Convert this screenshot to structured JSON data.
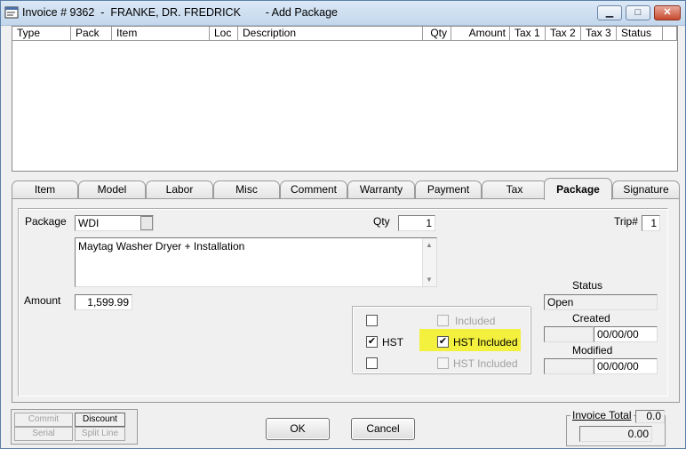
{
  "window": {
    "title": "Invoice # 9362  -  FRANKE, DR. FREDRICK        - Add Package",
    "minimize_glyph": "▁",
    "maximize_glyph": "□",
    "close_glyph": "✕"
  },
  "grid": {
    "columns": [
      "Type",
      "Pack",
      "Item",
      "Loc",
      "Description",
      "Qty",
      "Amount",
      "Tax 1",
      "Tax 2",
      "Tax 3",
      "Status"
    ]
  },
  "tabs": [
    {
      "label": "Item",
      "active": false
    },
    {
      "label": "Model",
      "active": false
    },
    {
      "label": "Labor",
      "active": false
    },
    {
      "label": "Misc",
      "active": false
    },
    {
      "label": "Comment",
      "active": false
    },
    {
      "label": "Warranty",
      "active": false
    },
    {
      "label": "Payment",
      "active": false
    },
    {
      "label": "Tax",
      "active": false
    },
    {
      "label": "Package",
      "active": true
    },
    {
      "label": "Signature",
      "active": false
    }
  ],
  "package": {
    "package_label": "Package",
    "package_value": "WDI",
    "qty_label": "Qty",
    "qty_value": "1",
    "trip_label": "Trip#",
    "trip_value": "1",
    "description": "Maytag Washer Dryer + Installation",
    "amount_label": "Amount",
    "amount_value": "1,599.99"
  },
  "tax": {
    "row1": {
      "label": "",
      "checked": false,
      "included_label": "Included",
      "included_checked": false
    },
    "row2": {
      "label": "HST",
      "checked": true,
      "included_label": "HST Included",
      "included_checked": true
    },
    "row3": {
      "label": "",
      "checked": false,
      "included_label": "HST Included",
      "included_checked": false
    }
  },
  "status": {
    "status_label": "Status",
    "status_value": "Open",
    "created_label": "Created",
    "created_value": "00/00/00",
    "modified_label": "Modified",
    "modified_value": "00/00/00"
  },
  "buttons": {
    "commit": "Commit",
    "discount": "Discount",
    "serial": "Serial",
    "split_line": "Split Line",
    "ok": "OK",
    "cancel": "Cancel"
  },
  "totals": {
    "invoice_total_label": "Invoice Total",
    "small_total": "0.0",
    "total_value": "0.00"
  },
  "colors": {
    "highlight": "#f3f03e",
    "window_border": "#5b7fa8"
  }
}
